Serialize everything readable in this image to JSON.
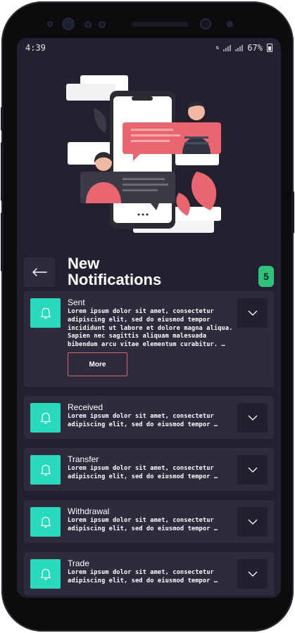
{
  "status_bar": {
    "time": "4:39",
    "battery": "67%"
  },
  "header": {
    "title": "New\nNotifications",
    "count": "5"
  },
  "notifications": [
    {
      "title": "Sent",
      "text": "Lorem ipsum dolor sit amet, consectetur adipiscing elit, sed do eiusmod tempor incididunt ut labore et dolore magna aliqua. Sapien nec sagittis aliquam malesuada bibendum arcu vitae elementum curabitur. …",
      "expanded": true,
      "more_label": "More"
    },
    {
      "title": "Received",
      "text": "Lorem ipsum dolor sit amet, consectetur adipiscing elit, sed do eiusmod tempor …"
    },
    {
      "title": "Transfer",
      "text": "Lorem ipsum dolor sit amet, consectetur adipiscing elit, sed do eiusmod tempor …"
    },
    {
      "title": "Withdrawal",
      "text": "Lorem ipsum dolor sit amet, consectetur adipiscing elit, sed do eiusmod tempor …"
    },
    {
      "title": "Trade",
      "text": "Lorem ipsum dolor sit amet, consectetur adipiscing elit, sed do eiusmod tempor …"
    }
  ],
  "icons": {
    "back": "arrow-left-icon",
    "item": "bell-icon",
    "expand": "chevron-down-icon"
  },
  "colors": {
    "background": "#252030",
    "card": "#2f2a3c",
    "accent_teal": "#28d9bd",
    "accent_coral": "#d7646e",
    "badge_green": "#2fc27a"
  }
}
